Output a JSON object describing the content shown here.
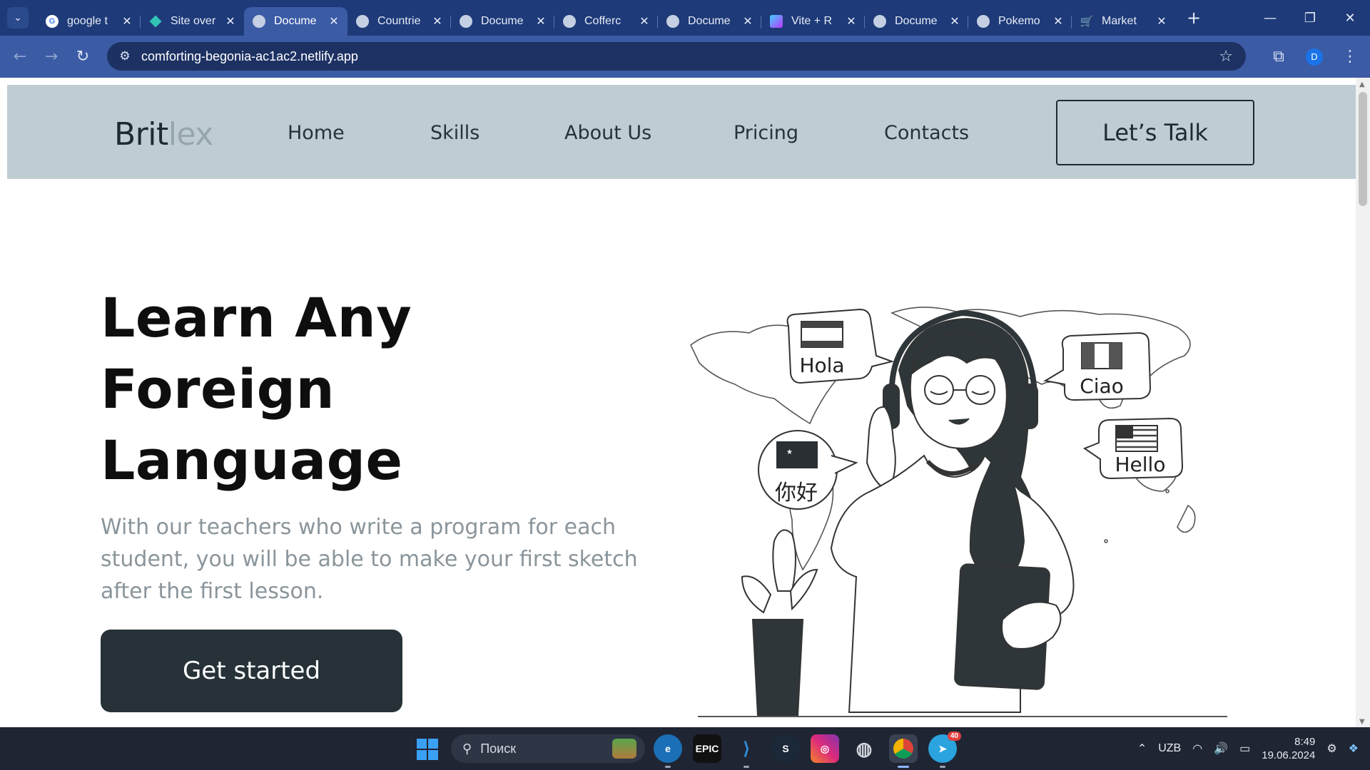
{
  "browser": {
    "tabs": [
      {
        "title": "google t",
        "icon": "google-icon",
        "active": false
      },
      {
        "title": "Site over",
        "icon": "netlify-icon",
        "active": false
      },
      {
        "title": "Docume",
        "icon": "globe-icon",
        "active": true
      },
      {
        "title": "Countrie",
        "icon": "globe-icon",
        "active": false
      },
      {
        "title": "Docume",
        "icon": "globe-icon",
        "active": false
      },
      {
        "title": "Cofferc",
        "icon": "globe-icon",
        "active": false
      },
      {
        "title": "Docume",
        "icon": "globe-icon",
        "active": false
      },
      {
        "title": "Vite + R",
        "icon": "vite-icon",
        "active": false
      },
      {
        "title": "Docume",
        "icon": "globe-icon",
        "active": false
      },
      {
        "title": "Pokemo",
        "icon": "globe-icon",
        "active": false
      },
      {
        "title": "Market",
        "icon": "cart-icon",
        "active": false
      }
    ],
    "url": "comforting-begonia-ac1ac2.netlify.app",
    "profile_initial": "D"
  },
  "site": {
    "logo": {
      "part1": "Brit",
      "part2": "lex"
    },
    "nav": [
      "Home",
      "Skills",
      "About Us",
      "Pricing",
      "Contacts"
    ],
    "cta": "Let’s Talk",
    "hero": {
      "title_lines": [
        "Learn Any",
        "Foreign",
        "Language"
      ],
      "subtitle": "With our teachers who write a program for each student, you will be able to make your first sketch after the first lesson.",
      "button": "Get started"
    },
    "illustration": {
      "bubbles": [
        "Hola",
        "Ciao",
        "你好",
        "Hello"
      ]
    },
    "colors": {
      "header_bg": "#bfcdd3",
      "dark": "#263238",
      "muted_text": "#8a959c"
    }
  },
  "taskbar": {
    "search_placeholder": "Поиск",
    "telegram_badge": "40",
    "language": "UZB",
    "time": "8:49",
    "date": "19.06.2024"
  }
}
